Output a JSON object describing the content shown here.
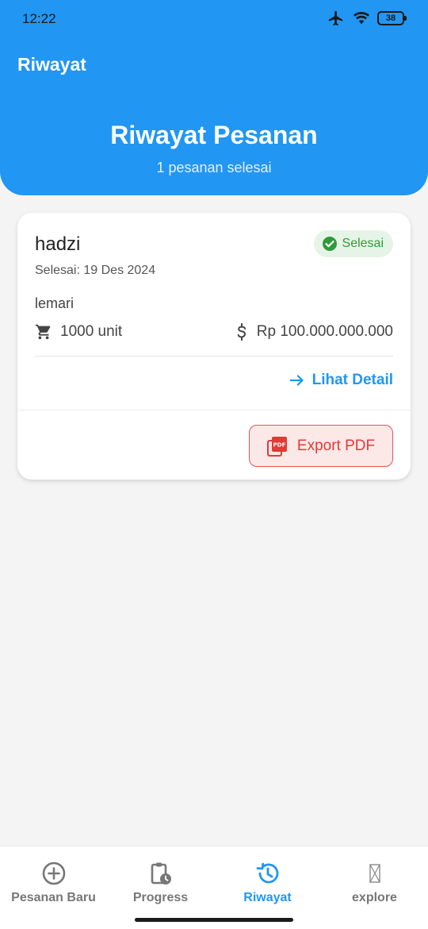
{
  "status_bar": {
    "time": "12:22",
    "battery": "38"
  },
  "app_bar": {
    "title": "Riwayat"
  },
  "header": {
    "title": "Riwayat Pesanan",
    "subtitle": "1 pesanan selesai"
  },
  "orders": [
    {
      "customer": "hadzi",
      "status": "Selesai",
      "date": "Selesai: 19 Des 2024",
      "product": "lemari",
      "quantity": "1000 unit",
      "price": "Rp 100.000.000.000",
      "detail_label": "Lihat Detail",
      "export_label": "Export PDF",
      "pdf_icon_text": "PDF"
    }
  ],
  "bottom_nav": {
    "items": [
      {
        "label": "Pesanan Baru",
        "icon": "add-circle-icon"
      },
      {
        "label": "Progress",
        "icon": "clipboard-clock-icon"
      },
      {
        "label": "Riwayat",
        "icon": "history-icon",
        "active": true
      },
      {
        "label": "explore",
        "icon": "missing-glyph-icon"
      }
    ]
  },
  "colors": {
    "primary": "#2196f3",
    "success": "#2e9b3a",
    "success_bg": "#e6f4e7",
    "danger": "#e53935",
    "danger_bg": "#fde8e8"
  }
}
